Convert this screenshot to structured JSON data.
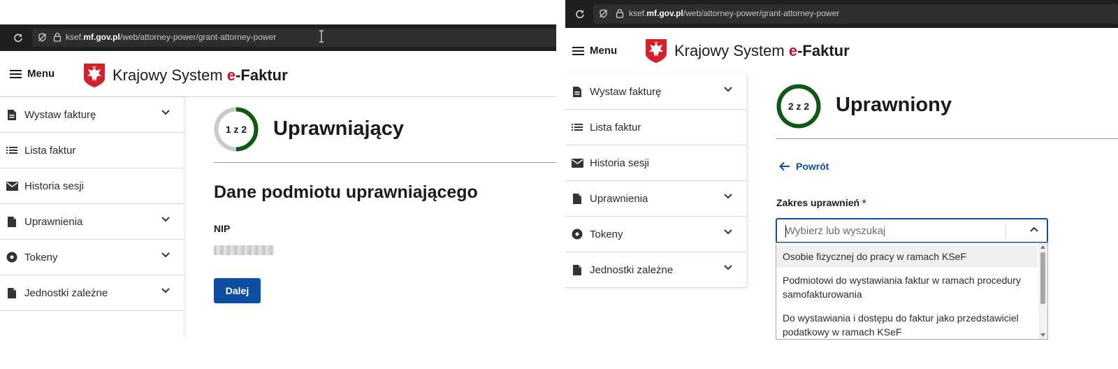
{
  "browser": {
    "url_prefix": "ksef.",
    "url_domain": "mf.gov.pl",
    "url_path": "/web/attorney-power/grant-attorney-power"
  },
  "header": {
    "menu_label": "Menu",
    "brand_part1": "Krajowy System ",
    "brand_e": "e",
    "brand_part2": "-Faktur"
  },
  "sidebar": {
    "items": [
      {
        "label": "Wystaw fakturę",
        "icon": "document-icon",
        "has_chevron": true
      },
      {
        "label": "Lista faktur",
        "icon": "list-icon",
        "has_chevron": false
      },
      {
        "label": "Historia sesji",
        "icon": "envelope-icon",
        "has_chevron": false
      },
      {
        "label": "Uprawnienia",
        "icon": "document-icon",
        "has_chevron": true
      },
      {
        "label": "Tokeny",
        "icon": "token-icon",
        "has_chevron": true
      },
      {
        "label": "Jednostki zależne",
        "icon": "document-icon",
        "has_chevron": true
      }
    ]
  },
  "left": {
    "step_label": "1 z 2",
    "step_current": 1,
    "step_total": 2,
    "title": "Uprawniający",
    "section_title": "Dane podmiotu uprawniającego",
    "nip_label": "NIP",
    "next_button": "Dalej"
  },
  "right": {
    "step_label": "2 z 2",
    "step_current": 2,
    "step_total": 2,
    "title": "Uprawniony",
    "back_link": "Powrót",
    "scope_label": "Zakres uprawnień",
    "required_marker": "*",
    "select_placeholder": "Wybierz lub wyszukaj",
    "options": [
      "Osobie fizycznej do pracy w ramach KSeF",
      "Podmiotowi do wystawiania faktur w ramach procedury samofakturowania",
      "Do wystawiania i dostępu do faktur jako przedstawiciel podatkowy w ramach KSeF"
    ]
  },
  "colors": {
    "primary": "#0b4ea2",
    "progress": "#0e5a14",
    "accent_red": "#c8102e"
  }
}
